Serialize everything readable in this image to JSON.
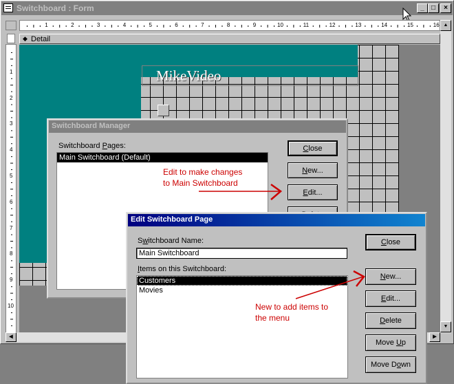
{
  "form_window": {
    "title": "Switchboard : Form",
    "section_label": "Detail",
    "ruler_h": [
      "1",
      "2",
      "3",
      "4",
      "5",
      "6",
      "7",
      "8",
      "9",
      "10",
      "11",
      "12",
      "13",
      "14",
      "15",
      "16"
    ],
    "ruler_v": [
      "1",
      "2",
      "3",
      "4",
      "5",
      "6",
      "7",
      "8",
      "9",
      "10"
    ],
    "label_text": "MikeVideo",
    "teal_color": "#008080"
  },
  "switchboard_manager": {
    "title": "Switchboard Manager",
    "pages_label": "Switchboard Pages:",
    "items": [
      "Main Switchboard (Default)"
    ],
    "buttons": {
      "close": "Close",
      "new": "New...",
      "edit": "Edit...",
      "delete": "Delete"
    }
  },
  "edit_page": {
    "title": "Edit Switchboard Page",
    "name_label": "Switchboard Name:",
    "name_value": "Main Switchboard",
    "items_label": "Items on this Switchboard:",
    "items": [
      "Customers",
      "Movies"
    ],
    "buttons": {
      "close": "Close",
      "new": "New...",
      "edit": "Edit...",
      "delete": "Delete",
      "move_up": "Move Up",
      "move_down": "Move Down"
    },
    "title_gradient": [
      "#000080",
      "#1084d0"
    ]
  },
  "annotations": {
    "edit_note": [
      "Edit to make changes",
      "to Main Switchboard"
    ],
    "new_note": [
      "New to add items to",
      "the menu"
    ],
    "color": "#cc0000"
  }
}
